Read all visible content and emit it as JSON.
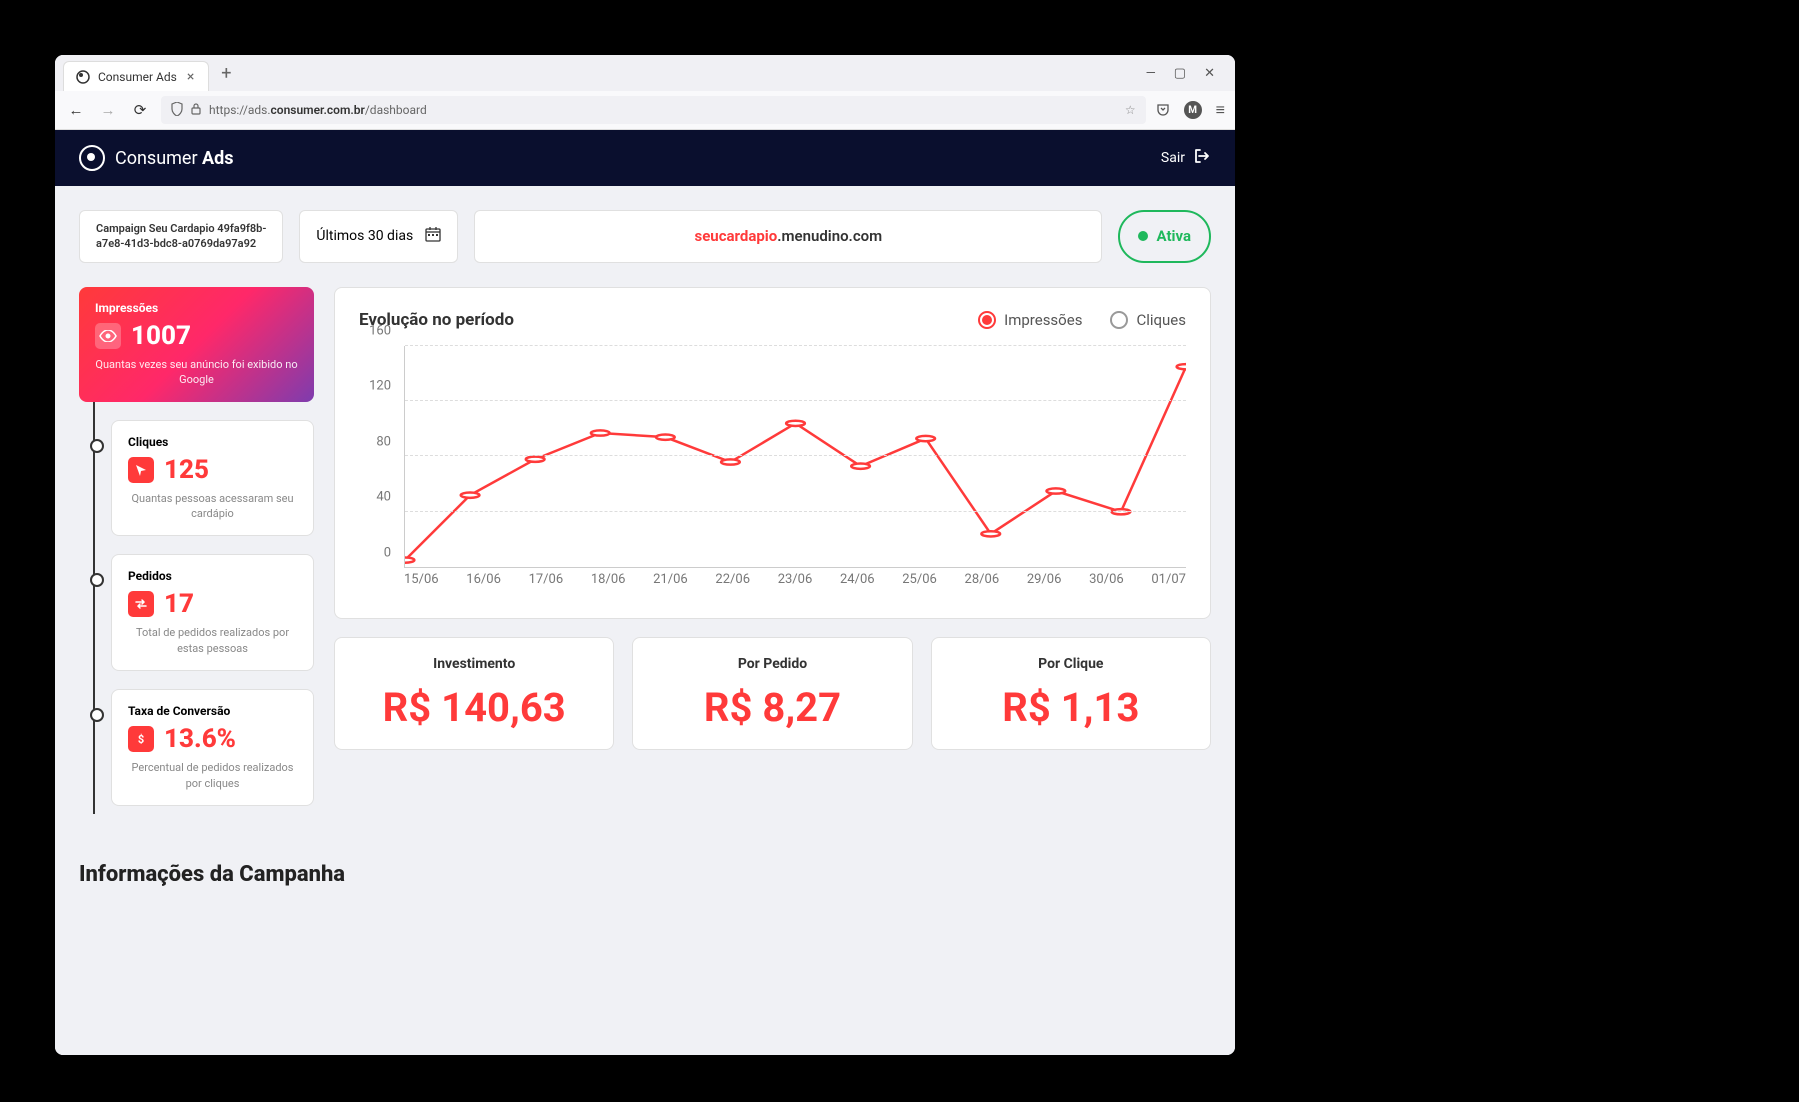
{
  "browser": {
    "tab_title": "Consumer Ads",
    "url_prefix": "https://ads.",
    "url_host": "consumer.com.br",
    "url_path": "/dashboard"
  },
  "header": {
    "brand": "Consumer",
    "brand_bold": "Ads",
    "logout": "Sair"
  },
  "top": {
    "campaign_line1": "Campaign Seu Cardapio 49fa9f8b-",
    "campaign_line2": "a7e8-41d3-bdc8-a0769da97a92",
    "period": "Últimos 30 dias",
    "subdomain": "seucardapio",
    "domain": ".menudino.com",
    "status": "Ativa"
  },
  "metrics": {
    "impressions": {
      "title": "Impressões",
      "value": "1007",
      "desc": "Quantas vezes seu anúncio foi exibido no Google"
    },
    "clicks": {
      "title": "Cliques",
      "value": "125",
      "desc": "Quantas pessoas acessaram seu cardápio"
    },
    "orders": {
      "title": "Pedidos",
      "value": "17",
      "desc": "Total de pedidos realizados por estas pessoas"
    },
    "conversion": {
      "title": "Taxa de Conversão",
      "value": "13.6%",
      "desc": "Percentual de pedidos realizados por cliques"
    }
  },
  "chart": {
    "title": "Evolução no período",
    "toggle_impressions": "Impressões",
    "toggle_clicks": "Cliques"
  },
  "chart_data": {
    "type": "line",
    "title": "Evolução no período",
    "xlabel": "",
    "ylabel": "",
    "ylim": [
      0,
      160
    ],
    "y_ticks": [
      "0",
      "40",
      "80",
      "120",
      "160"
    ],
    "categories": [
      "15/06",
      "16/06",
      "17/06",
      "18/06",
      "21/06",
      "22/06",
      "23/06",
      "24/06",
      "25/06",
      "28/06",
      "29/06",
      "30/06",
      "01/07"
    ],
    "series": [
      {
        "name": "Impressões",
        "values": [
          5,
          52,
          78,
          97,
          94,
          76,
          104,
          73,
          93,
          24,
          55,
          40,
          145
        ]
      }
    ]
  },
  "bottom": {
    "investment": {
      "label": "Investimento",
      "value": "R$ 140,63"
    },
    "per_order": {
      "label": "Por Pedido",
      "value": "R$ 8,27"
    },
    "per_click": {
      "label": "Por Clique",
      "value": "R$ 1,13"
    }
  },
  "section": {
    "campaign_info": "Informações da Campanha"
  }
}
